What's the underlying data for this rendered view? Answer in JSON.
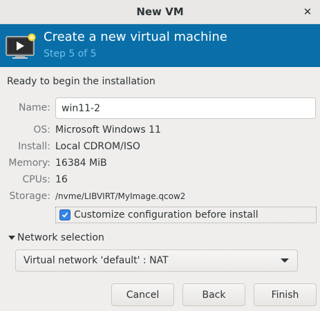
{
  "window": {
    "title": "New VM",
    "close_icon": "close-icon"
  },
  "banner": {
    "heading": "Create a new virtual machine",
    "step": "Step 5 of 5",
    "background_color": "#0a6fa8",
    "step_color": "#6ec0ea",
    "icon": "vm-play-icon"
  },
  "summary": {
    "ready_text": "Ready to begin the installation",
    "name_label": "Name:",
    "name_value": "win11-2",
    "os_label": "OS:",
    "os_value": "Microsoft Windows 11",
    "install_label": "Install:",
    "install_value": "Local CDROM/ISO",
    "memory_label": "Memory:",
    "memory_value": "16384 MiB",
    "cpus_label": "CPUs:",
    "cpus_value": "16",
    "storage_label": "Storage:",
    "storage_value": "/nvme/LIBVIRT/MyImage.qcow2"
  },
  "customize": {
    "label": "Customize configuration before install",
    "checked": true,
    "accent_color": "#3584e4"
  },
  "network": {
    "section_label": "Network selection",
    "expanded": true,
    "selected": "Virtual network 'default' : NAT"
  },
  "buttons": {
    "cancel": "Cancel",
    "back": "Back",
    "finish": "Finish"
  }
}
